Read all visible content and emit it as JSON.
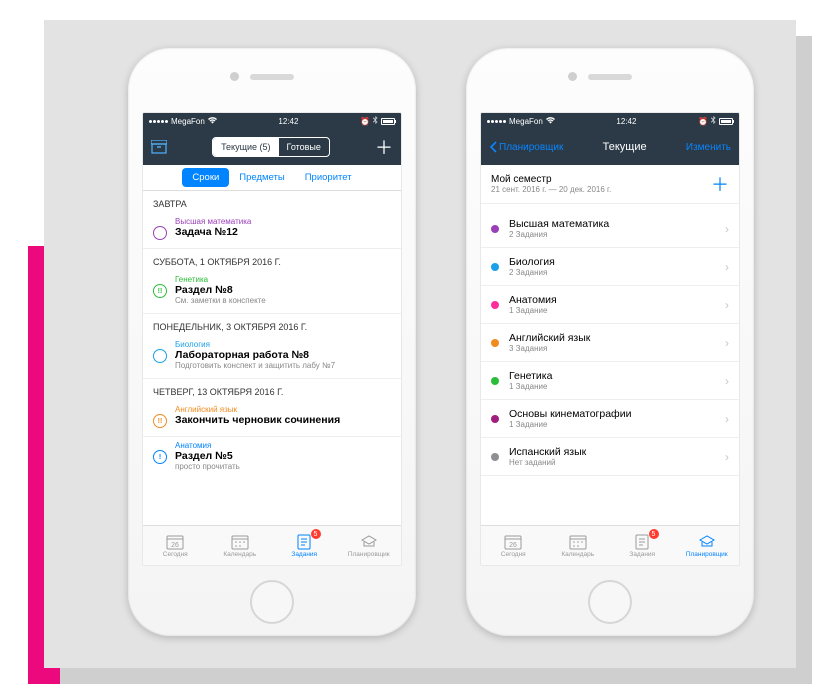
{
  "statusbar": {
    "carrier": "MegaFon",
    "time": "12:42"
  },
  "phone1": {
    "seg": {
      "active": "Текущие (5)",
      "inactive": "Готовые"
    },
    "subnav": [
      "Сроки",
      "Предметы",
      "Приоритет"
    ],
    "sections": [
      {
        "header": "ЗАВТРА",
        "tasks": [
          {
            "subject": "Высшая математика",
            "title": "Задача №12",
            "note": "",
            "color": "#9b3fb8"
          }
        ]
      },
      {
        "header": "СУББОТА, 1 ОКТЯБРЯ 2016 Г.",
        "tasks": [
          {
            "subject": "Генетика",
            "title": "Раздел №8",
            "note": "См. заметки в конспекте",
            "color": "#2bbd3a",
            "bang": true
          }
        ]
      },
      {
        "header": "ПОНЕДЕЛЬНИК, 3 ОКТЯБРЯ 2016 Г.",
        "tasks": [
          {
            "subject": "Биология",
            "title": "Лабораторная работа №8",
            "note": "Подготовить конспект и защитить лабу №7",
            "color": "#1aa0e8"
          }
        ]
      },
      {
        "header": "ЧЕТВЕРГ, 13 ОКТЯБРЯ 2016 Г.",
        "tasks": [
          {
            "subject": "Английский язык",
            "title": "Закончить черновик сочинения",
            "note": "",
            "color": "#f08b1d",
            "bang": true
          },
          {
            "subject": "Анатомия",
            "title": "Раздел №5",
            "note": "просто прочитать",
            "color": "#0084ff",
            "info": true
          }
        ]
      }
    ]
  },
  "phone2": {
    "nav": {
      "back": "Планировщик",
      "title": "Текущие",
      "edit": "Изменить"
    },
    "semester": {
      "title": "Мой семестр",
      "dates": "21 сент. 2016 г. — 20 дек. 2016 г."
    },
    "subjects": [
      {
        "name": "Высшая математика",
        "count": "2 Задания",
        "color": "#9b3fb8"
      },
      {
        "name": "Биология",
        "count": "2 Задания",
        "color": "#1aa0e8"
      },
      {
        "name": "Анатомия",
        "count": "1 Задание",
        "color": "#ff2d9b"
      },
      {
        "name": "Английский язык",
        "count": "3 Задания",
        "color": "#f08b1d"
      },
      {
        "name": "Генетика",
        "count": "1 Задание",
        "color": "#2bbd3a"
      },
      {
        "name": "Основы кинематографии",
        "count": "1 Задание",
        "color": "#a01d7d"
      },
      {
        "name": "Испанский язык",
        "count": "Нет заданий",
        "color": "#8e8e93"
      }
    ]
  },
  "tabbar": {
    "items": [
      "Сегодня",
      "Календарь",
      "Задания",
      "Планировщик"
    ],
    "calendarDay": "26",
    "badge": "5"
  }
}
